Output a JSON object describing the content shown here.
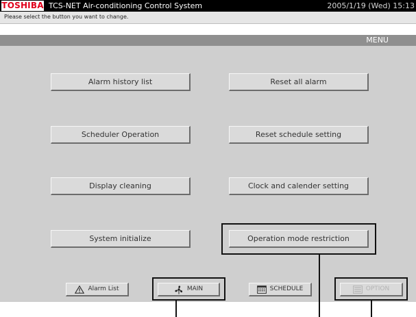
{
  "header": {
    "brand": "TOSHIBA",
    "app_title": "TCS-NET Air-conditioning Control System",
    "datetime": "2005/1/19 (Wed)  15:13"
  },
  "instruction": "Please select the button you want to change.",
  "screen_label": "MENU",
  "menu_buttons": {
    "alarm_history": "Alarm history list",
    "reset_alarm": "Reset all alarm",
    "scheduler_operation": "Scheduler Operation",
    "reset_schedule": "Reset schedule setting",
    "display_cleaning": "Display cleaning",
    "clock_calendar": "Clock and calender setting",
    "system_initialize": "System initialize",
    "operation_mode_restriction": "Operation mode restriction"
  },
  "nav_buttons": {
    "alarm_list": {
      "label": "Alarm List",
      "icon": "warning-icon"
    },
    "main": {
      "label": "MAIN",
      "icon": "fan-icon"
    },
    "schedule": {
      "label": "SCHEDULE",
      "icon": "calendar-icon"
    },
    "option": {
      "label": "OPTION",
      "icon": "option-icon",
      "state": "disabled"
    }
  },
  "colors": {
    "brand_red": "#e0001b",
    "title_bar": "#000000",
    "panel": "#cfcfcf",
    "menu_bar": "#8f8f8f"
  }
}
